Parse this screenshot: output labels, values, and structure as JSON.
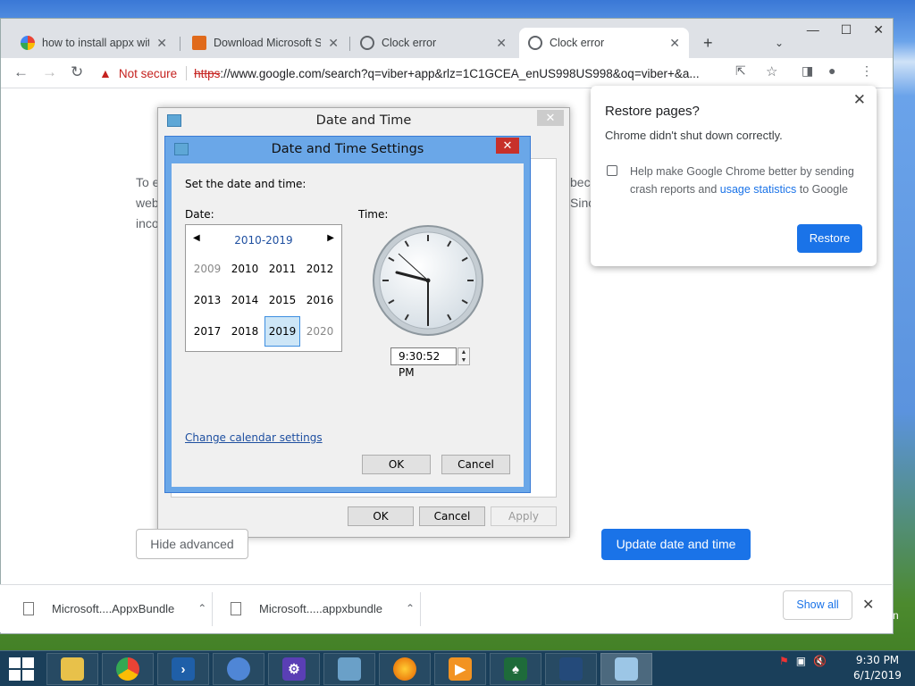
{
  "browser": {
    "tabs": [
      {
        "label": "how to install appx with",
        "icon": "google-icon",
        "active": false
      },
      {
        "label": "Download Microsoft Su",
        "icon": "site-icon",
        "active": false
      },
      {
        "label": "Clock error",
        "icon": "globe-icon",
        "active": false
      },
      {
        "label": "Clock error",
        "icon": "globe-icon",
        "active": true
      }
    ],
    "new_tab": "+",
    "omnibox": {
      "security_label": "Not secure",
      "scheme": "https",
      "url_rest": "://www.google.com/search?q=viber+app&rlz=1C1GCEA_enUS998US998&oq=viber+&a..."
    }
  },
  "page": {
    "body_fragments": [
      "To e",
      "web",
      "inco",
      "beca",
      "Sinc"
    ],
    "hide_advanced": "Hide advanced",
    "update_button": "Update date and time"
  },
  "outer_dialog": {
    "title": "Date and Time",
    "ok": "OK",
    "cancel": "Cancel",
    "apply": "Apply"
  },
  "inner_dialog": {
    "title": "Date and Time Settings",
    "prompt": "Set the date and time:",
    "date_label": "Date:",
    "time_label": "Time:",
    "calendar": {
      "range": "2010-2019",
      "years": [
        "2009",
        "2010",
        "2011",
        "2012",
        "2013",
        "2014",
        "2015",
        "2016",
        "2017",
        "2018",
        "2019",
        "2020"
      ],
      "selected": "2019"
    },
    "time_value": "9:30:52 PM",
    "change_calendar": "Change calendar settings",
    "ok": "OK",
    "cancel": "Cancel"
  },
  "restore_popup": {
    "title": "Restore pages?",
    "subtitle": "Chrome didn't shut down correctly.",
    "help_text": "Help make Google Chrome better by sending crash reports and",
    "usage_link": "usage statistics",
    "help_tail": "to Google",
    "button": "Restore"
  },
  "downloads": {
    "items": [
      "Microsoft....AppxBundle",
      "Microsoft.....appxbundle"
    ],
    "show_all": "Show all"
  },
  "taskbar": {
    "time": "9:30 PM",
    "date": "6/1/2019",
    "edge_letter": "n"
  },
  "colors": {
    "accent": "#1a73e8",
    "danger": "#c5221f",
    "dialog_frame": "#6aa7e8"
  }
}
